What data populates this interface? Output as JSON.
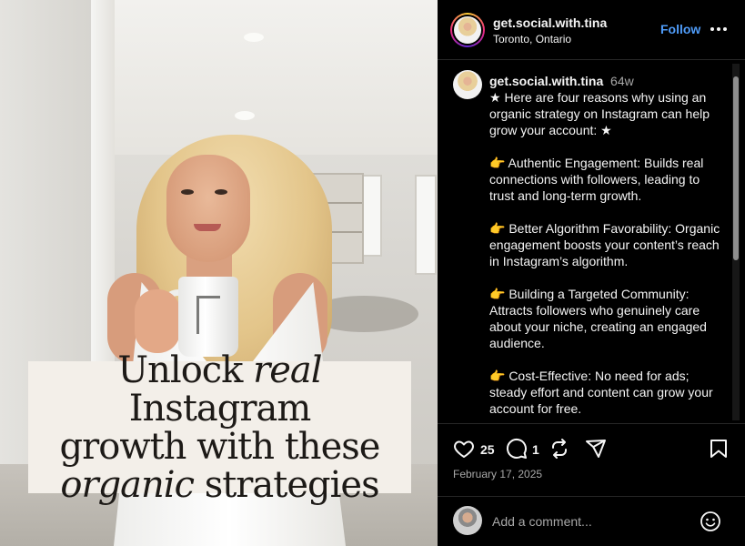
{
  "overlay": {
    "line1_a": "Unlock ",
    "line1_b": "real",
    "line1_c": " Instagram",
    "line2": "growth with these",
    "line3_a": "organic",
    "line3_b": " strategies"
  },
  "header": {
    "username": "get.social.with.tina",
    "location": "Toronto, Ontario",
    "follow_label": "Follow",
    "more_icon": "more-horizontal-icon"
  },
  "caption": {
    "username": "get.social.with.tina",
    "time": "64w",
    "text": "★ Here are four reasons why using an organic strategy on Instagram can help grow your account: ★\n\n👉 Authentic Engagement: Builds real connections with followers, leading to trust and long-term growth.\n\n👉 Better Algorithm Favorability: Organic engagement boosts your content’s reach in Instagram’s algorithm.\n\n👉 Building a Targeted Community: Attracts followers who genuinely care about your niche, creating an engaged audience.\n\n👉 Cost-Effective: No need for ads; steady effort and content can grow your account for free."
  },
  "actions": {
    "likes": "25",
    "comments": "1",
    "date": "February 17, 2025"
  },
  "comment": {
    "placeholder": "Add a comment..."
  },
  "colors": {
    "link_blue": "#4f9cf9",
    "background": "#000000",
    "muted": "#a8a8a8"
  }
}
